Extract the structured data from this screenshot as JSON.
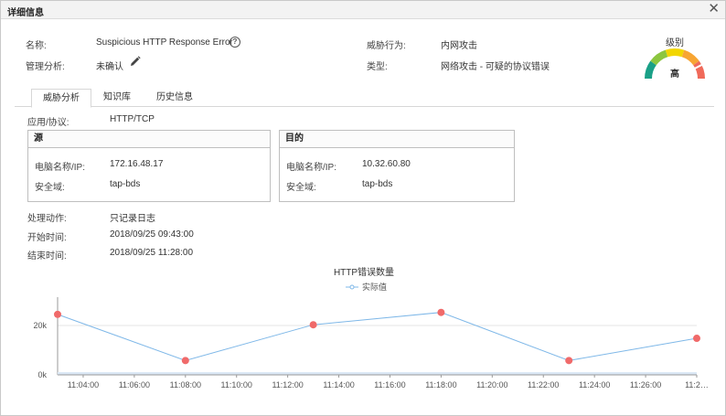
{
  "dialog": {
    "title": "详细信息",
    "close": "✕"
  },
  "header": {
    "name_label": "名称:",
    "name_value": "Suspicious HTTP Response Error",
    "help_glyph": "?",
    "analysis_label": "管理分析:",
    "analysis_value": "未确认",
    "behavior_label": "威胁行为:",
    "behavior_value": "内网攻击",
    "type_label": "类型:",
    "type_value": "网络攻击 - 可疑的协议错误",
    "level_title": "级别",
    "level_value": "高",
    "level_fraction": 0.85,
    "gauge_colors": [
      "#1aa087",
      "#8cc63f",
      "#f2d600",
      "#f7a533",
      "#f06a5a"
    ]
  },
  "tabs": [
    {
      "label": "威胁分析",
      "active": true
    },
    {
      "label": "知识库",
      "active": false
    },
    {
      "label": "历史信息",
      "active": false
    }
  ],
  "details": {
    "protocol_label": "应用/协议:",
    "protocol_value": "HTTP/TCP",
    "source": {
      "title": "源",
      "ip_label": "电脑名称/IP:",
      "ip_value": "172.16.48.17",
      "zone_label": "安全域:",
      "zone_value": "tap-bds"
    },
    "target": {
      "title": "目的",
      "ip_label": "电脑名称/IP:",
      "ip_value": "10.32.60.80",
      "zone_label": "安全域:",
      "zone_value": "tap-bds"
    },
    "action_label": "处理动作:",
    "action_value": "只记录日志",
    "start_label": "开始时间:",
    "start_value": "2018/09/25 09:43:00",
    "end_label": "结束时间:",
    "end_value": "2018/09/25 11:28:00"
  },
  "chart_data": {
    "type": "line",
    "title": "HTTP错误数量",
    "series": [
      {
        "name": "实际值",
        "color": "#7fb8e8",
        "marker_color": "#f06a6a",
        "x": [
          "11:03:00",
          "11:08:00",
          "11:13:00",
          "11:18:00",
          "11:23:00",
          "11:28:00"
        ],
        "values": [
          24500,
          5800,
          20300,
          25300,
          5800,
          14800
        ]
      }
    ],
    "x_ticks": [
      "11:04:00",
      "11:06:00",
      "11:08:00",
      "11:10:00",
      "11:12:00",
      "11:14:00",
      "11:16:00",
      "11:18:00",
      "11:20:00",
      "11:22:00",
      "11:24:00",
      "11:26:00",
      "11:2…"
    ],
    "x_range": [
      "11:03:00",
      "11:28:00"
    ],
    "y_ticks": [
      "0k",
      "20k"
    ],
    "ylim": [
      0,
      30000
    ],
    "legend_position": "top-center",
    "grid": true
  }
}
